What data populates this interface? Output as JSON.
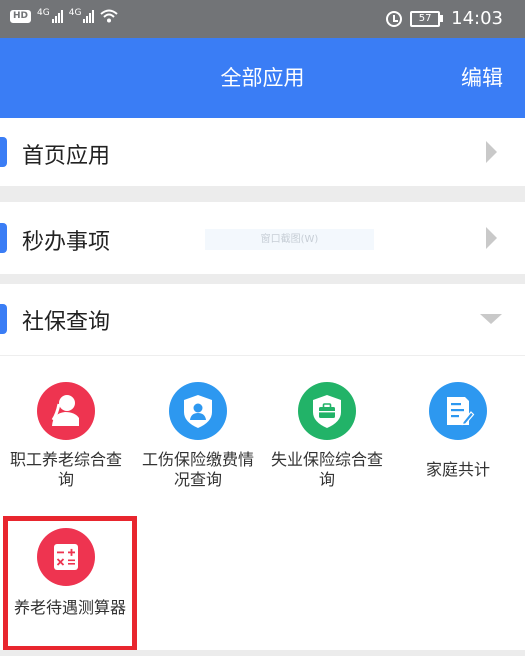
{
  "status_bar": {
    "hd": "HD",
    "net1": "4G",
    "net2": "4G",
    "battery": "57",
    "time": "14:03"
  },
  "header": {
    "title": "全部应用",
    "edit_label": "编辑"
  },
  "sections": [
    {
      "label": "首页应用",
      "state": "collapsed"
    },
    {
      "label": "秒办事项",
      "state": "collapsed"
    },
    {
      "label": "社保查询",
      "state": "expanded"
    }
  ],
  "overlay_tip": "窗口截图(W)",
  "apps": [
    {
      "label": "职工养老综合查询",
      "icon": "elderly-person-icon",
      "color": "#ee3450"
    },
    {
      "label": "工伤保险缴费情况查询",
      "icon": "shield-person-icon",
      "color": "#2d98f0"
    },
    {
      "label": "失业保险综合查询",
      "icon": "shield-briefcase-icon",
      "color": "#22b368"
    },
    {
      "label": "家庭共计",
      "icon": "document-edit-icon",
      "color": "#2d98f0"
    },
    {
      "label": "养老待遇测算器",
      "icon": "calculator-icon",
      "color": "#ee3450"
    }
  ],
  "colors": {
    "accent": "#3a7df5",
    "highlight": "#e8262e"
  }
}
